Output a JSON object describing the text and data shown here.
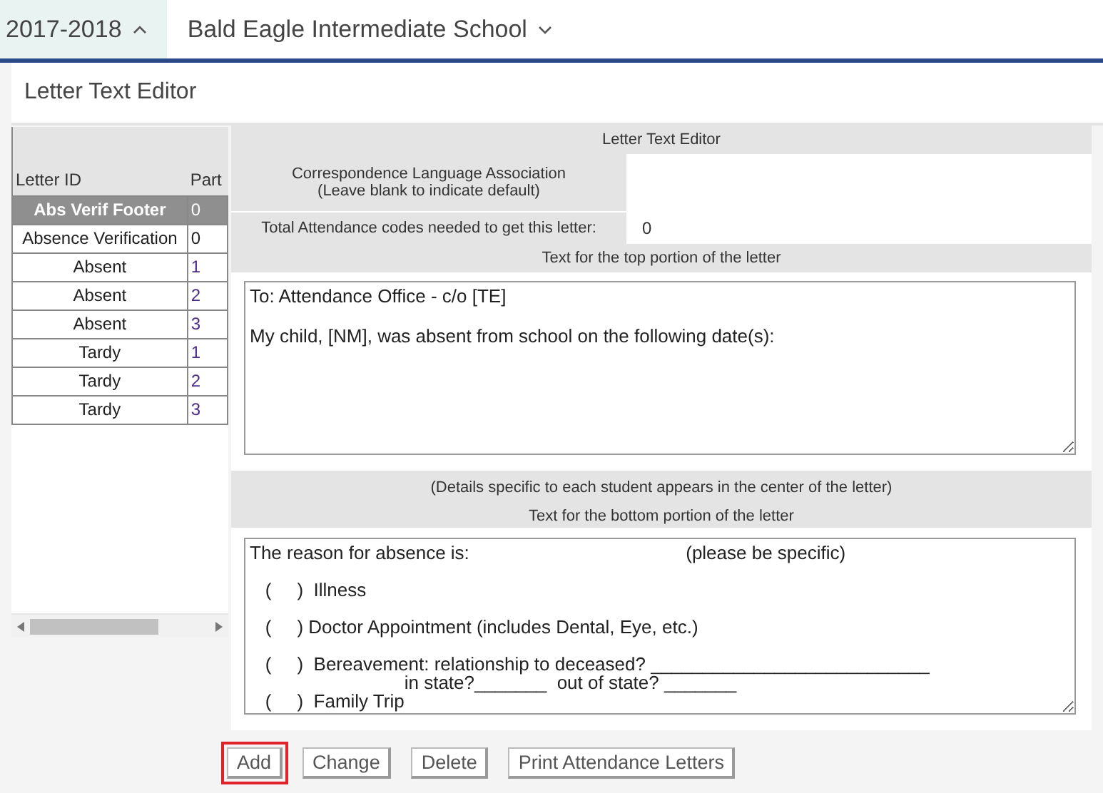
{
  "top_bar": {
    "year": {
      "label": "2017-2018",
      "expanded": true
    },
    "school": {
      "label": "Bald Eagle Intermediate School",
      "expanded": false
    }
  },
  "page_title": "Letter Text Editor",
  "letter_table": {
    "columns": [
      "Letter ID",
      "Part"
    ],
    "rows": [
      {
        "letter_id": "Abs Verif Footer",
        "part": "0",
        "selected": true
      },
      {
        "letter_id": "Absence Verification",
        "part": "0",
        "selected": false
      },
      {
        "letter_id": "Absent",
        "part": "1",
        "selected": false
      },
      {
        "letter_id": "Absent",
        "part": "2",
        "selected": false
      },
      {
        "letter_id": "Absent",
        "part": "3",
        "selected": false
      },
      {
        "letter_id": "Tardy",
        "part": "1",
        "selected": false
      },
      {
        "letter_id": "Tardy",
        "part": "2",
        "selected": false
      },
      {
        "letter_id": "Tardy",
        "part": "3",
        "selected": false
      }
    ]
  },
  "editor": {
    "heading": "Letter Text Editor",
    "language_label": "Correspondence Language Association\n(Leave blank to indicate default)",
    "codes_label": "Total Attendance codes needed to get this letter:",
    "codes_value": "0",
    "top_heading": "Text for the top portion of the letter",
    "top_text": "To: Attendance Office - c/o [TE]\n\nMy child, [NM], was absent from school on the following date(s):",
    "details_note": "(Details specific to each student appears in the center of the letter)",
    "bottom_heading": "Text for the bottom portion of the letter",
    "bottom_text": "The reason for absence is:                                          (please be specific)\n\n   (     )  Illness\n\n   (     ) Doctor Appointment (includes Dental, Eye, etc.)\n\n   (     )  Bereavement: relationship to deceased? ___________________________\n                              in state?_______  out of state? _______\n   (     )  Family Trip"
  },
  "buttons": [
    {
      "label": "Add",
      "highlighted": true
    },
    {
      "label": "Change",
      "highlighted": false
    },
    {
      "label": "Delete",
      "highlighted": false
    },
    {
      "label": "Print Attendance Letters",
      "highlighted": false
    }
  ]
}
